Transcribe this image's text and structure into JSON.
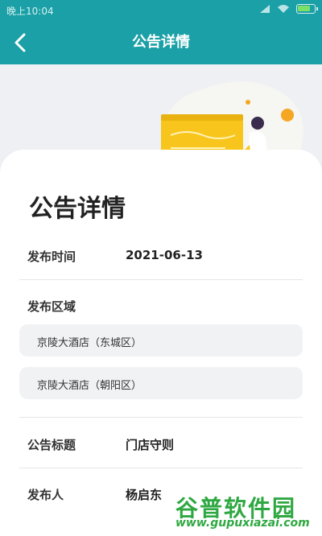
{
  "status_bar": {
    "time": "晚上10:04",
    "icons": [
      "signal-icon",
      "wifi-icon",
      "battery-icon"
    ],
    "battery_level": 0.85
  },
  "header": {
    "title": "公告详情",
    "back_icon": "back-arrow-icon"
  },
  "page": {
    "heading": "公告详情"
  },
  "details": {
    "publish_time": {
      "label": "发布时间",
      "value": "2021-06-13"
    },
    "region": {
      "label": "发布区域",
      "items": [
        "京陵大酒店（东城区）",
        "京陵大酒店（朝阳区）"
      ]
    },
    "notice_title": {
      "label": "公告标题",
      "value": "门店守则"
    },
    "publisher": {
      "label": "发布人",
      "value": "杨启东"
    }
  },
  "watermark": {
    "title": "谷普软件园",
    "url": "www.gupuxiazai.com"
  },
  "colors": {
    "primary": "#1aa0a6",
    "illustration_yellow": "#f8c51c",
    "watermark_green": "#2fa842"
  }
}
